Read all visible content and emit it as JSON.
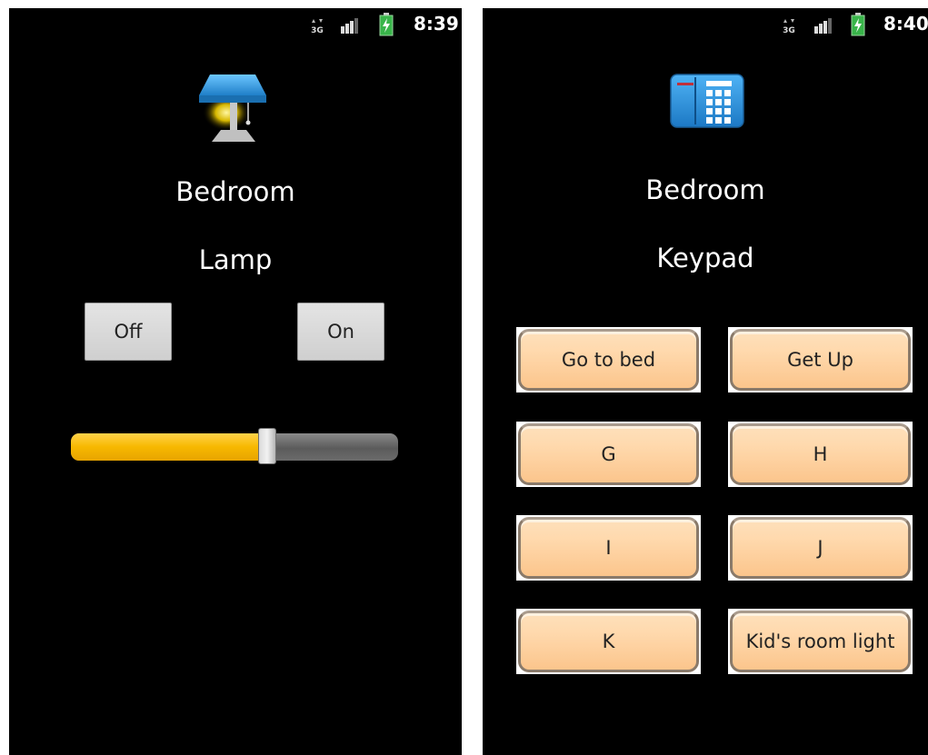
{
  "screens": [
    {
      "id": "lamp",
      "status": {
        "time": "8:39",
        "network": "3G"
      },
      "icon": "lamp-icon",
      "room": "Bedroom",
      "device": "Lamp",
      "off_label": "Off",
      "on_label": "On",
      "dimmer_level": 0.6
    },
    {
      "id": "keypad",
      "status": {
        "time": "8:40",
        "network": "3G"
      },
      "icon": "keypad-icon",
      "room": "Bedroom",
      "device": "Keypad",
      "buttons": [
        "Go to bed",
        "Get Up",
        "G",
        "H",
        "I",
        "J",
        "K",
        "Kid's room light"
      ]
    }
  ],
  "colors": {
    "accent_slider": "#f7b800",
    "key_button": "#fbc58c",
    "battery": "#39b54a",
    "icon_blue": "#3a9be0"
  }
}
